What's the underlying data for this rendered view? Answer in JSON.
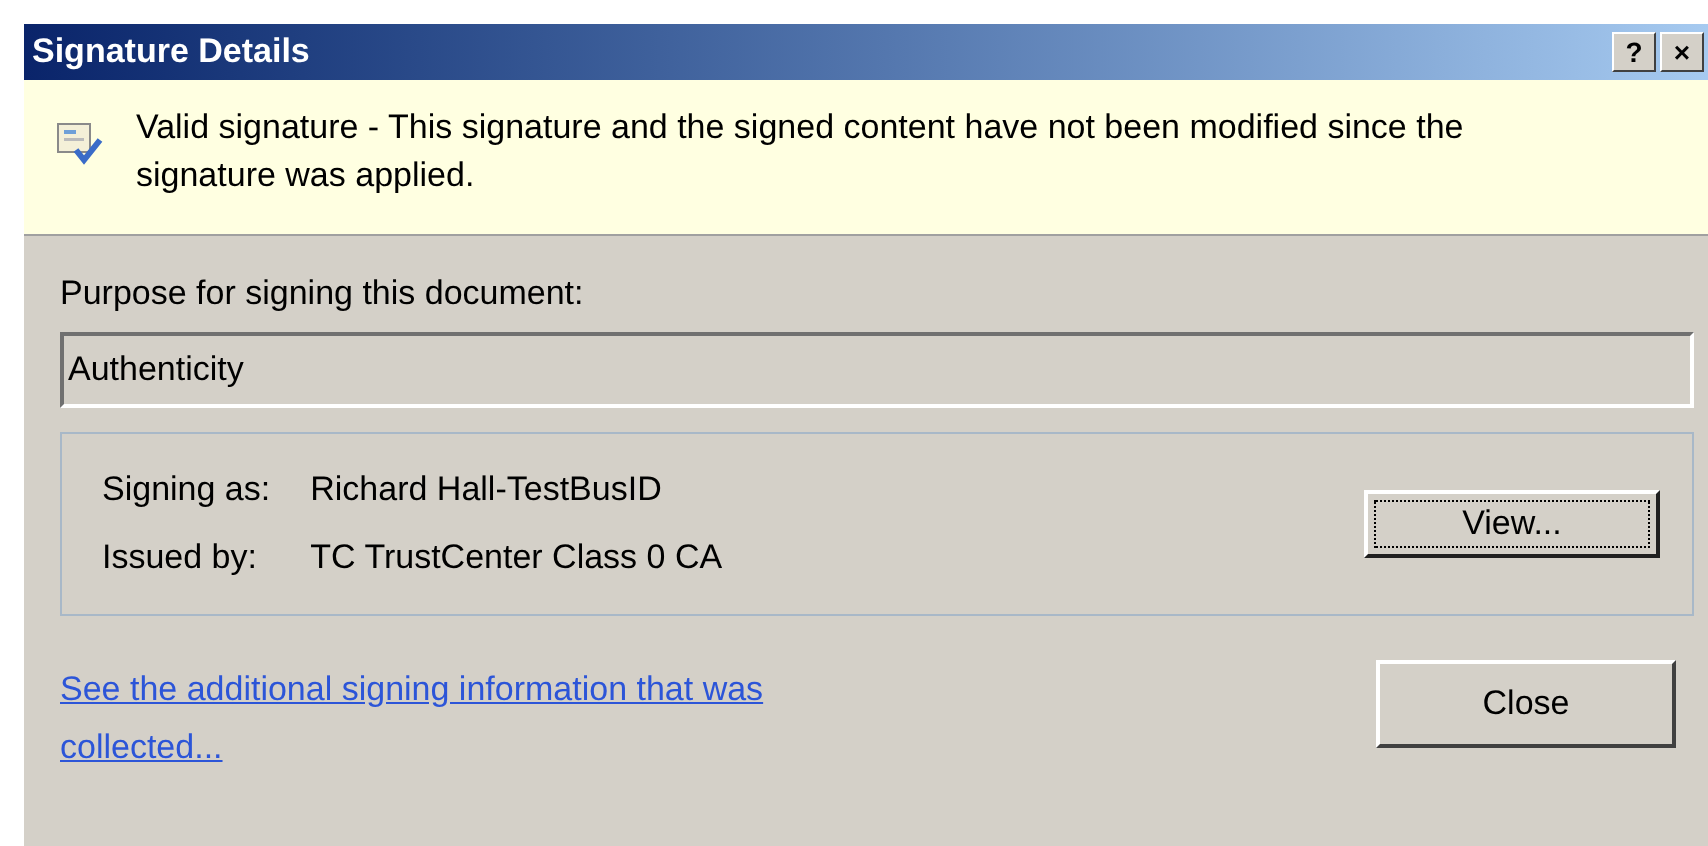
{
  "window": {
    "title": "Signature Details",
    "title_buttons": [
      "?",
      "×"
    ]
  },
  "banner": {
    "text": "Valid signature - This signature and the signed content have not been modified since the signature was applied."
  },
  "purpose": {
    "label": "Purpose for signing this document:",
    "value": "Authenticity"
  },
  "details": [
    {
      "label": "Signing as:",
      "value": "Richard Hall-TestBusID"
    },
    {
      "label": "Issued by:",
      "value": "TC TrustCenter Class 0 CA"
    }
  ],
  "view_button": {
    "label": "View..."
  },
  "link": {
    "text": "See the additional signing information that was collected..."
  },
  "close_button": {
    "label": "Close"
  }
}
